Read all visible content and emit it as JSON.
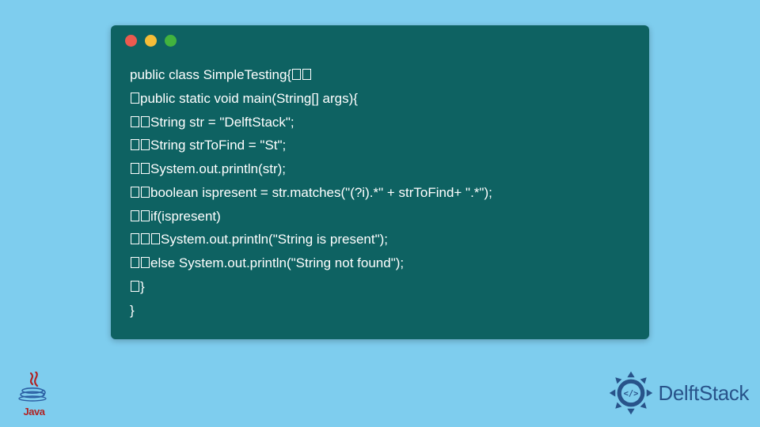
{
  "window": {
    "dots": {
      "red": "#ec5a4f",
      "yellow": "#f5bd38",
      "green": "#42b33e"
    }
  },
  "code": {
    "l1_a": "public class SimpleTesting{",
    "l2_a": "public static void main(String[] args){",
    "l3_a": "String str = \"DelftStack\";",
    "l4_a": "String strToFind  = \"St\";",
    "l5_a": "System.out.println(str);",
    "l6_a": "boolean ispresent = str.matches(\"(?i).*\" + strToFind+ \".*\");",
    "l7_a": "if(ispresent)",
    "l8_a": "System.out.println(\"String is present\");",
    "l9_a": "else System.out.println(\"String not found\");",
    "l10_a": "}",
    "l11_a": "}"
  },
  "logos": {
    "java_label": "Java",
    "delft_label": "DelftStack"
  },
  "colors": {
    "page_bg": "#7ecdee",
    "window_bg": "#0e6262",
    "code_fg": "#ffffff",
    "java_fg": "#b02424",
    "delft_fg": "#28538a"
  }
}
